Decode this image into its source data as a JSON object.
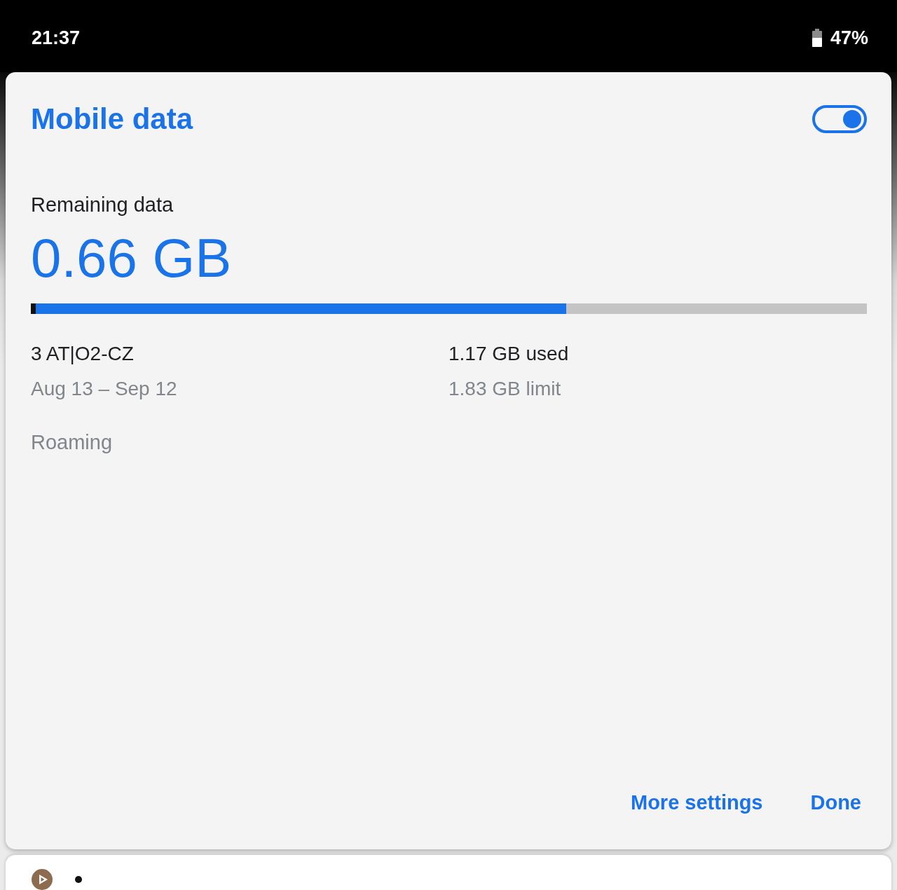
{
  "status_bar": {
    "time": "21:37",
    "battery_percent": "47%"
  },
  "dialog": {
    "title": "Mobile data",
    "toggle": {
      "on": true
    },
    "remaining_label": "Remaining data",
    "remaining_amount": "0.66 GB",
    "usage": {
      "level": 0.64
    },
    "details": [
      {
        "primary": "3 AT|O2-CZ",
        "secondary": "Aug 13 – Sep 12"
      },
      {
        "primary": "1.17 GB used",
        "secondary": "1.83 GB limit"
      }
    ],
    "roaming_label": "Roaming",
    "buttons": [
      {
        "label": "More settings"
      },
      {
        "label": "Done"
      }
    ]
  }
}
